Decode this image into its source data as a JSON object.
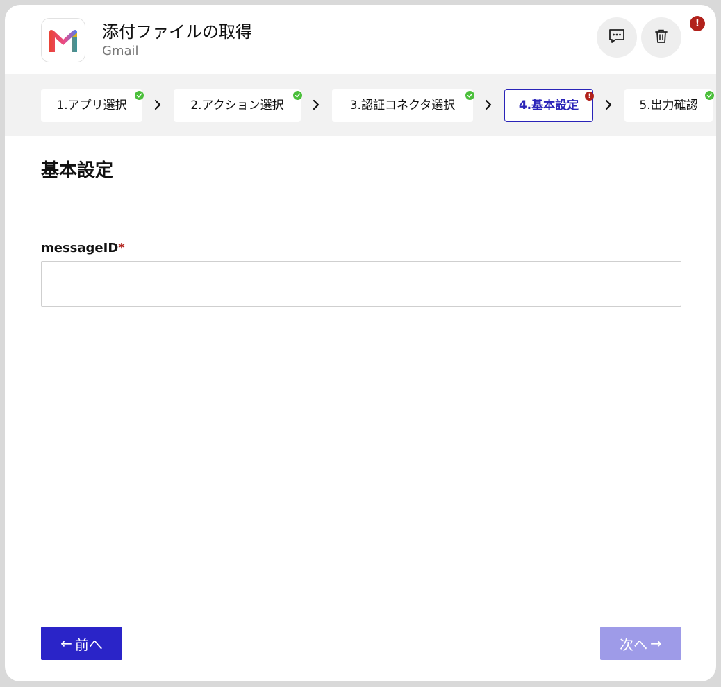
{
  "header": {
    "title": "添付ファイルの取得",
    "app_name": "Gmail",
    "alert_badge": "!"
  },
  "icons": {
    "app_logo": "gmail-logo",
    "comment": "comment-icon",
    "delete": "trash-icon",
    "step_done": "check-icon",
    "step_error": "exclamation-icon",
    "separator": "chevron-right-icon"
  },
  "steps": [
    {
      "label": "1.アプリ選択",
      "status": "done"
    },
    {
      "label": "2.アクション選択",
      "status": "done"
    },
    {
      "label": "3.認証コネクタ選択",
      "status": "done"
    },
    {
      "label": "4.基本設定",
      "status": "error"
    },
    {
      "label": "5.出力確認",
      "status": "done"
    }
  ],
  "step_error_mark": "!",
  "section_title": "基本設定",
  "form": {
    "message_id": {
      "label": "messageID",
      "required_mark": "*",
      "value": ""
    }
  },
  "footer": {
    "prev_label": "前へ",
    "prev_arrow": "←",
    "next_label": "次へ",
    "next_arrow": "→"
  },
  "colors": {
    "primary": "#2a24c8",
    "primary_disabled": "#9e9be8",
    "success": "#4bbf3b",
    "error": "#b1211b"
  }
}
